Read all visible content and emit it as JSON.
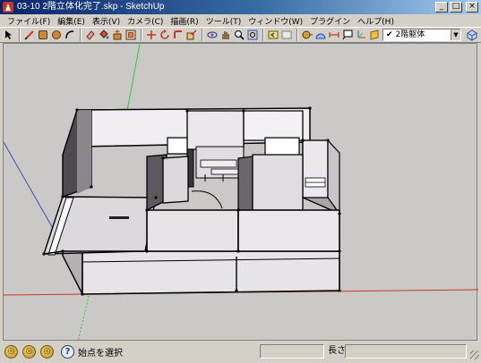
{
  "window": {
    "title": "03-10 2階立体化完了.skp - SketchUp",
    "controls": {
      "minimize": "_",
      "maximize": "□",
      "close": "×"
    }
  },
  "menu": [
    "ファイル(F)",
    "編集(E)",
    "表示(V)",
    "カメラ(C)",
    "描画(R)",
    "ツール(T)",
    "ウィンドウ(W)",
    "プラグイン",
    "ヘルプ(H)"
  ],
  "toolbar": {
    "tools": [
      "select-arrow-icon",
      "pencil-line-icon",
      "rectangle-icon",
      "circle-icon",
      "arc-icon",
      "eraser-icon",
      "paint-bucket-icon",
      "push-pull-icon",
      "offset-icon",
      "move-icon",
      "rotate-icon",
      "follow-me-icon",
      "scale-icon",
      "orbit-icon",
      "pan-icon",
      "zoom-icon",
      "zoom-extents-icon",
      "previous-view-icon",
      "next-view-icon",
      "tape-measure-icon",
      "protractor-icon",
      "dimension-icon",
      "text-icon",
      "axes-icon",
      "section-plane-icon",
      "components-icon",
      "get-models-icon",
      "share-model-icon"
    ],
    "layer": {
      "check": "✔",
      "name": "2階躯体"
    }
  },
  "axis_colors": {
    "red": "#c0392b",
    "green": "#2ecc40",
    "blue": "#3a4fb8"
  },
  "status": {
    "message": "始点を選択",
    "measurements_label": "長さ",
    "measurements_value": ""
  }
}
